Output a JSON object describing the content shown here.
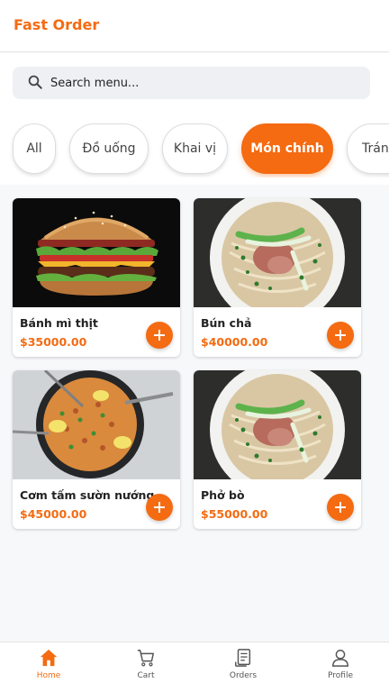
{
  "header": {
    "title": "Fast Order"
  },
  "search": {
    "placeholder": "Search menu..."
  },
  "categories": [
    {
      "label": "All",
      "active": false
    },
    {
      "label": "Đồ uống",
      "active": false
    },
    {
      "label": "Khai vị",
      "active": false
    },
    {
      "label": "Món chính",
      "active": true
    },
    {
      "label": "Tráng miệng",
      "active": false
    }
  ],
  "products": [
    {
      "name": "Bánh mì thịt",
      "price": "$35000.00",
      "image": "burger"
    },
    {
      "name": "Bún chả",
      "price": "$40000.00",
      "image": "noodle-soup"
    },
    {
      "name": "Cơm tấm sườn nướng",
      "price": "$45000.00",
      "image": "fried-rice"
    },
    {
      "name": "Phở bò",
      "price": "$55000.00",
      "image": "noodle-soup"
    }
  ],
  "nav": [
    {
      "label": "Home",
      "icon": "home-icon",
      "active": true
    },
    {
      "label": "Cart",
      "icon": "cart-icon",
      "active": false
    },
    {
      "label": "Orders",
      "icon": "orders-icon",
      "active": false
    },
    {
      "label": "Profile",
      "icon": "profile-icon",
      "active": false
    }
  ],
  "colors": {
    "accent": "#f46b12",
    "background": "#f7f8fa"
  }
}
